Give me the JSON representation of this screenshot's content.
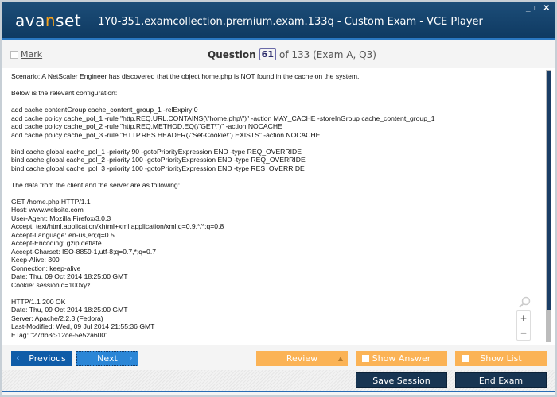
{
  "window": {
    "logo_pre": "ava",
    "logo_n": "n",
    "logo_post": "set",
    "title": "1Y0-351.examcollection.premium.exam.133q - Custom Exam - VCE Player",
    "controls": {
      "minimize": "_",
      "maximize": "□",
      "close": "✕"
    }
  },
  "question_bar": {
    "mark_label": "Mark",
    "question_label": "Question",
    "question_number": "61",
    "of_text": "of 133 (Exam A, Q3)"
  },
  "content": {
    "lines": [
      "Scenario: A NetScaler Engineer has discovered that the object home.php is NOT found in the cache on the system.",
      "",
      "Below is the relevant configuration:",
      "",
      "add cache contentGroup cache_content_group_1 -relExpiry 0",
      "add cache policy cache_pol_1 -rule \"http.REQ.URL.CONTAINS(\\\"home.php\\\")\" -action MAY_CACHE -storeInGroup cache_content_group_1",
      "add cache policy cache_pol_2 -rule \"http.REQ.METHOD.EQ(\\\"GET\\\")\" -action NOCACHE",
      "add cache policy cache_pol_3 -rule \"HTTP.RES.HEADER(\\\"Set-Cookie\\\").EXISTS\" -action NOCACHE",
      "",
      "bind cache global cache_pol_1 -priority 90 -gotoPriorityExpression END -type REQ_OVERRIDE",
      "bind cache global cache_pol_2 -priority 100 -gotoPriorityExpression END -type REQ_OVERRIDE",
      "bind cache global cache_pol_3 -priority 100 -gotoPriorityExpression END -type RES_OVERRIDE",
      "",
      "The data from the client and the server are as following:",
      "",
      "GET /home.php HTTP/1.1",
      "Host: www.website.com",
      "User-Agent: Mozilla Firefox/3.0.3",
      "Accept: text/html,application/xhtml+xml,application/xml;q=0.9,*/*;q=0.8",
      "Accept-Language: en-us,en;q=0.5",
      "Accept-Encoding: gzip,deflate",
      "Accept-Charset: ISO-8859-1,utf-8;q=0.7,*;q=0.7",
      "Keep-Alive: 300",
      "Connection: keep-alive",
      "Date: Thu, 09 Oct 2014 18:25:00 GMT",
      "Cookie: sessionid=100xyz",
      "",
      "HTTP/1.1 200 OK",
      "Date: Thu, 09 Oct 2014 18:25:00 GMT",
      "Server: Apache/2.2.3 (Fedora)",
      "Last-Modified: Wed, 09 Jul 2014 21:55:36 GMT",
      "ETag: \"27db3c-12ce-5e52a600\""
    ],
    "zoom_in": "+",
    "zoom_out": "−"
  },
  "nav": {
    "previous": "Previous",
    "next": "Next",
    "review": "Review",
    "show_answer": "Show Answer",
    "show_list": "Show List"
  },
  "footer": {
    "save_session": "Save Session",
    "end_exam": "End Exam"
  },
  "colors": {
    "titlebar": "#0f3a62",
    "accent_orange": "#fbb356",
    "nav_blue": "#0f5ca8",
    "dark_button": "#183552"
  }
}
